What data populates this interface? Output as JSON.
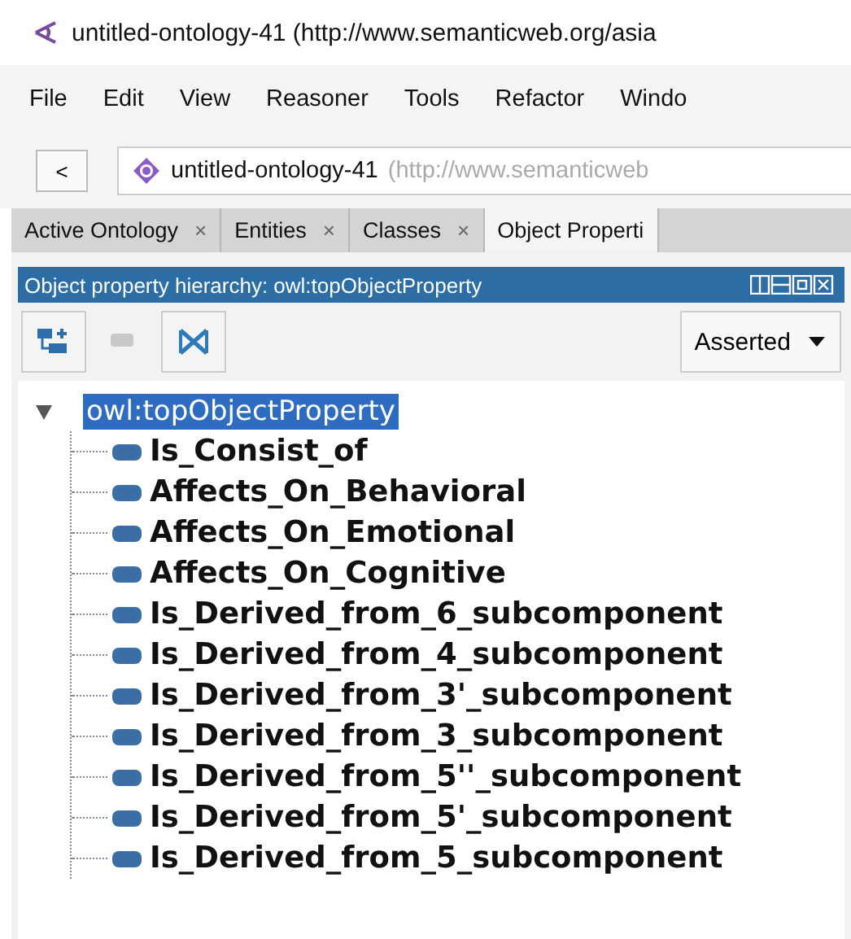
{
  "window": {
    "title": "untitled-ontology-41 (http://www.semanticweb.org/asia"
  },
  "menu": [
    "File",
    "Edit",
    "View",
    "Reasoner",
    "Tools",
    "Refactor",
    "Windo"
  ],
  "navigation": {
    "back": "<",
    "ontology_name": "untitled-ontology-41",
    "ontology_iri": "(http://www.semanticweb"
  },
  "tabs": [
    {
      "label": "Active Ontology",
      "close": "×",
      "selected": false
    },
    {
      "label": "Entities",
      "close": "×",
      "selected": false
    },
    {
      "label": "Classes",
      "close": "×",
      "selected": false
    },
    {
      "label": "Object Properti",
      "selected": true
    }
  ],
  "panel": {
    "title": "Object property hierarchy: owl:topObjectProperty",
    "view_selector": "Asserted"
  },
  "tree": [
    {
      "label": "owl:topObjectProperty",
      "selected": true,
      "expanded": true,
      "children": [
        {
          "label": "Is_Consist_of",
          "selected": false
        },
        {
          "label": "Affects_On_Behavioral",
          "selected": false
        },
        {
          "label": "Affects_On_Emotional",
          "selected": false
        },
        {
          "label": "Affects_On_Cognitive",
          "selected": false
        },
        {
          "label": "Is_Derived_from_6_subcomponent",
          "selected": false
        },
        {
          "label": "Is_Derived_from_4_subcomponent",
          "selected": false
        },
        {
          "label": "Is_Derived_from_3'_subcomponent",
          "selected": false
        },
        {
          "label": "Is_Derived_from_3_subcomponent",
          "selected": false
        },
        {
          "label": "Is_Derived_from_5''_subcomponent",
          "selected": false
        },
        {
          "label": "Is_Derived_from_5'_subcomponent",
          "selected": false
        },
        {
          "label": "Is_Derived_from_5_subcomponent",
          "selected": false
        }
      ]
    }
  ]
}
